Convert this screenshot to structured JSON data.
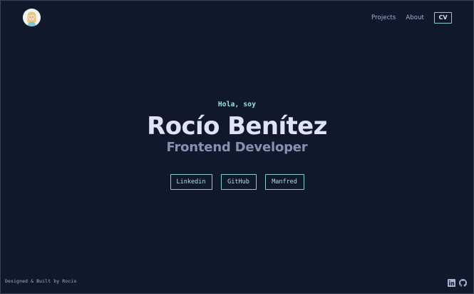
{
  "header": {
    "avatar_icon": "cartoon-avatar-icon",
    "nav": {
      "projects_label": "Projects",
      "about_label": "About",
      "cv_label": "CV"
    }
  },
  "hero": {
    "greeting": "Hola, soy",
    "name": "Rocío Benítez",
    "role": "Frontend Developer",
    "links": {
      "linkedin_label": "Linkedin",
      "github_label": "GitHub",
      "manfred_label": "Manfred"
    }
  },
  "footer": {
    "credit": "Designed & Built by Rocio",
    "icons": [
      "linkedin-icon",
      "github-icon"
    ]
  },
  "colors": {
    "background": "#0f192b",
    "accent": "#8ecbd0",
    "heading": "#dfe3f5",
    "muted": "#8892b0"
  }
}
